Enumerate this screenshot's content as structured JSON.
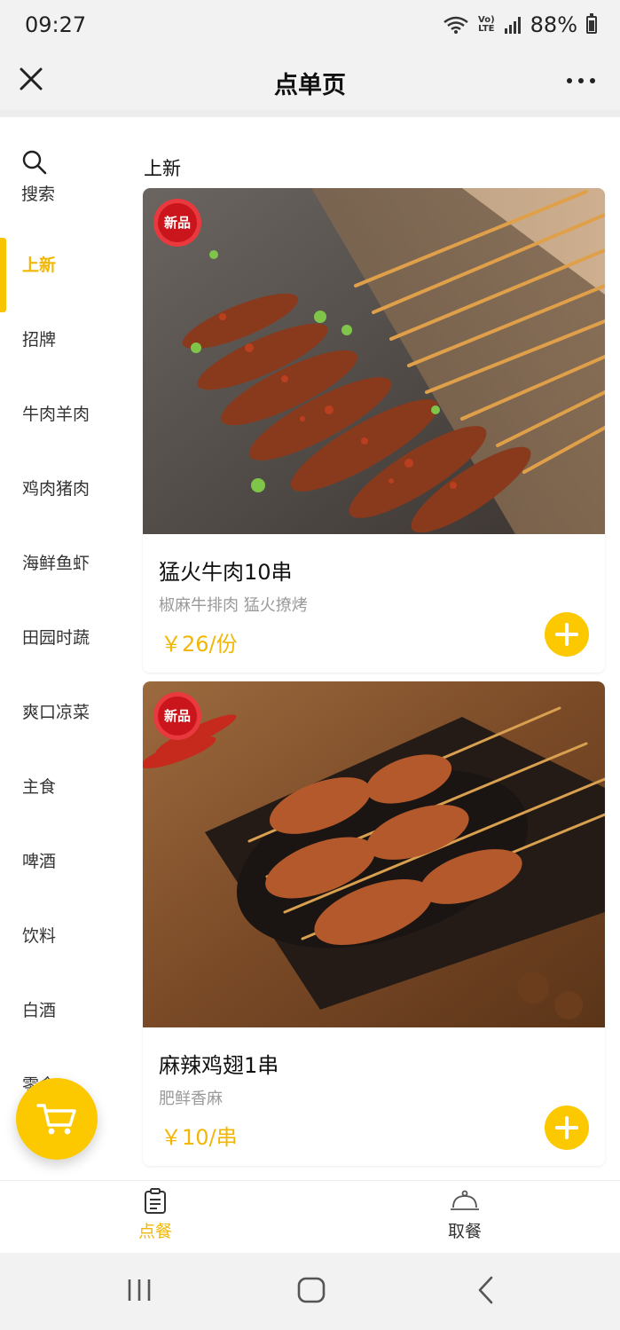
{
  "status_bar": {
    "time": "09:27",
    "battery": "88%",
    "network": "VoLTE",
    "wifi": "6"
  },
  "header": {
    "title": "点单页"
  },
  "sidebar": {
    "search_label": "搜索",
    "items": [
      {
        "label": "上新",
        "active": true
      },
      {
        "label": "招牌"
      },
      {
        "label": "牛肉羊肉"
      },
      {
        "label": "鸡肉猪肉"
      },
      {
        "label": "海鲜鱼虾"
      },
      {
        "label": "田园时蔬"
      },
      {
        "label": "爽口凉菜"
      },
      {
        "label": "主食"
      },
      {
        "label": "啤酒"
      },
      {
        "label": "饮料"
      },
      {
        "label": "白酒"
      },
      {
        "label": "零食"
      }
    ]
  },
  "section": {
    "title": "上新"
  },
  "products": [
    {
      "badge": "新品",
      "name": "猛火牛肉10串",
      "desc": "椒麻牛排肉 猛火撩烤",
      "price": "￥26/份"
    },
    {
      "badge": "新品",
      "name": "麻辣鸡翅1串",
      "desc": "肥鲜香麻",
      "price": "￥10/串"
    }
  ],
  "tabbar": {
    "order_label": "点餐",
    "pickup_label": "取餐"
  },
  "colors": {
    "accent": "#fcc800",
    "accent_text": "#f2b705",
    "badge_red": "#d0161b"
  },
  "icons": {
    "close": "close-icon",
    "more": "more-icon",
    "search": "search-icon",
    "cart": "cart-icon",
    "order": "clipboard-icon",
    "pickup": "cloche-icon"
  }
}
